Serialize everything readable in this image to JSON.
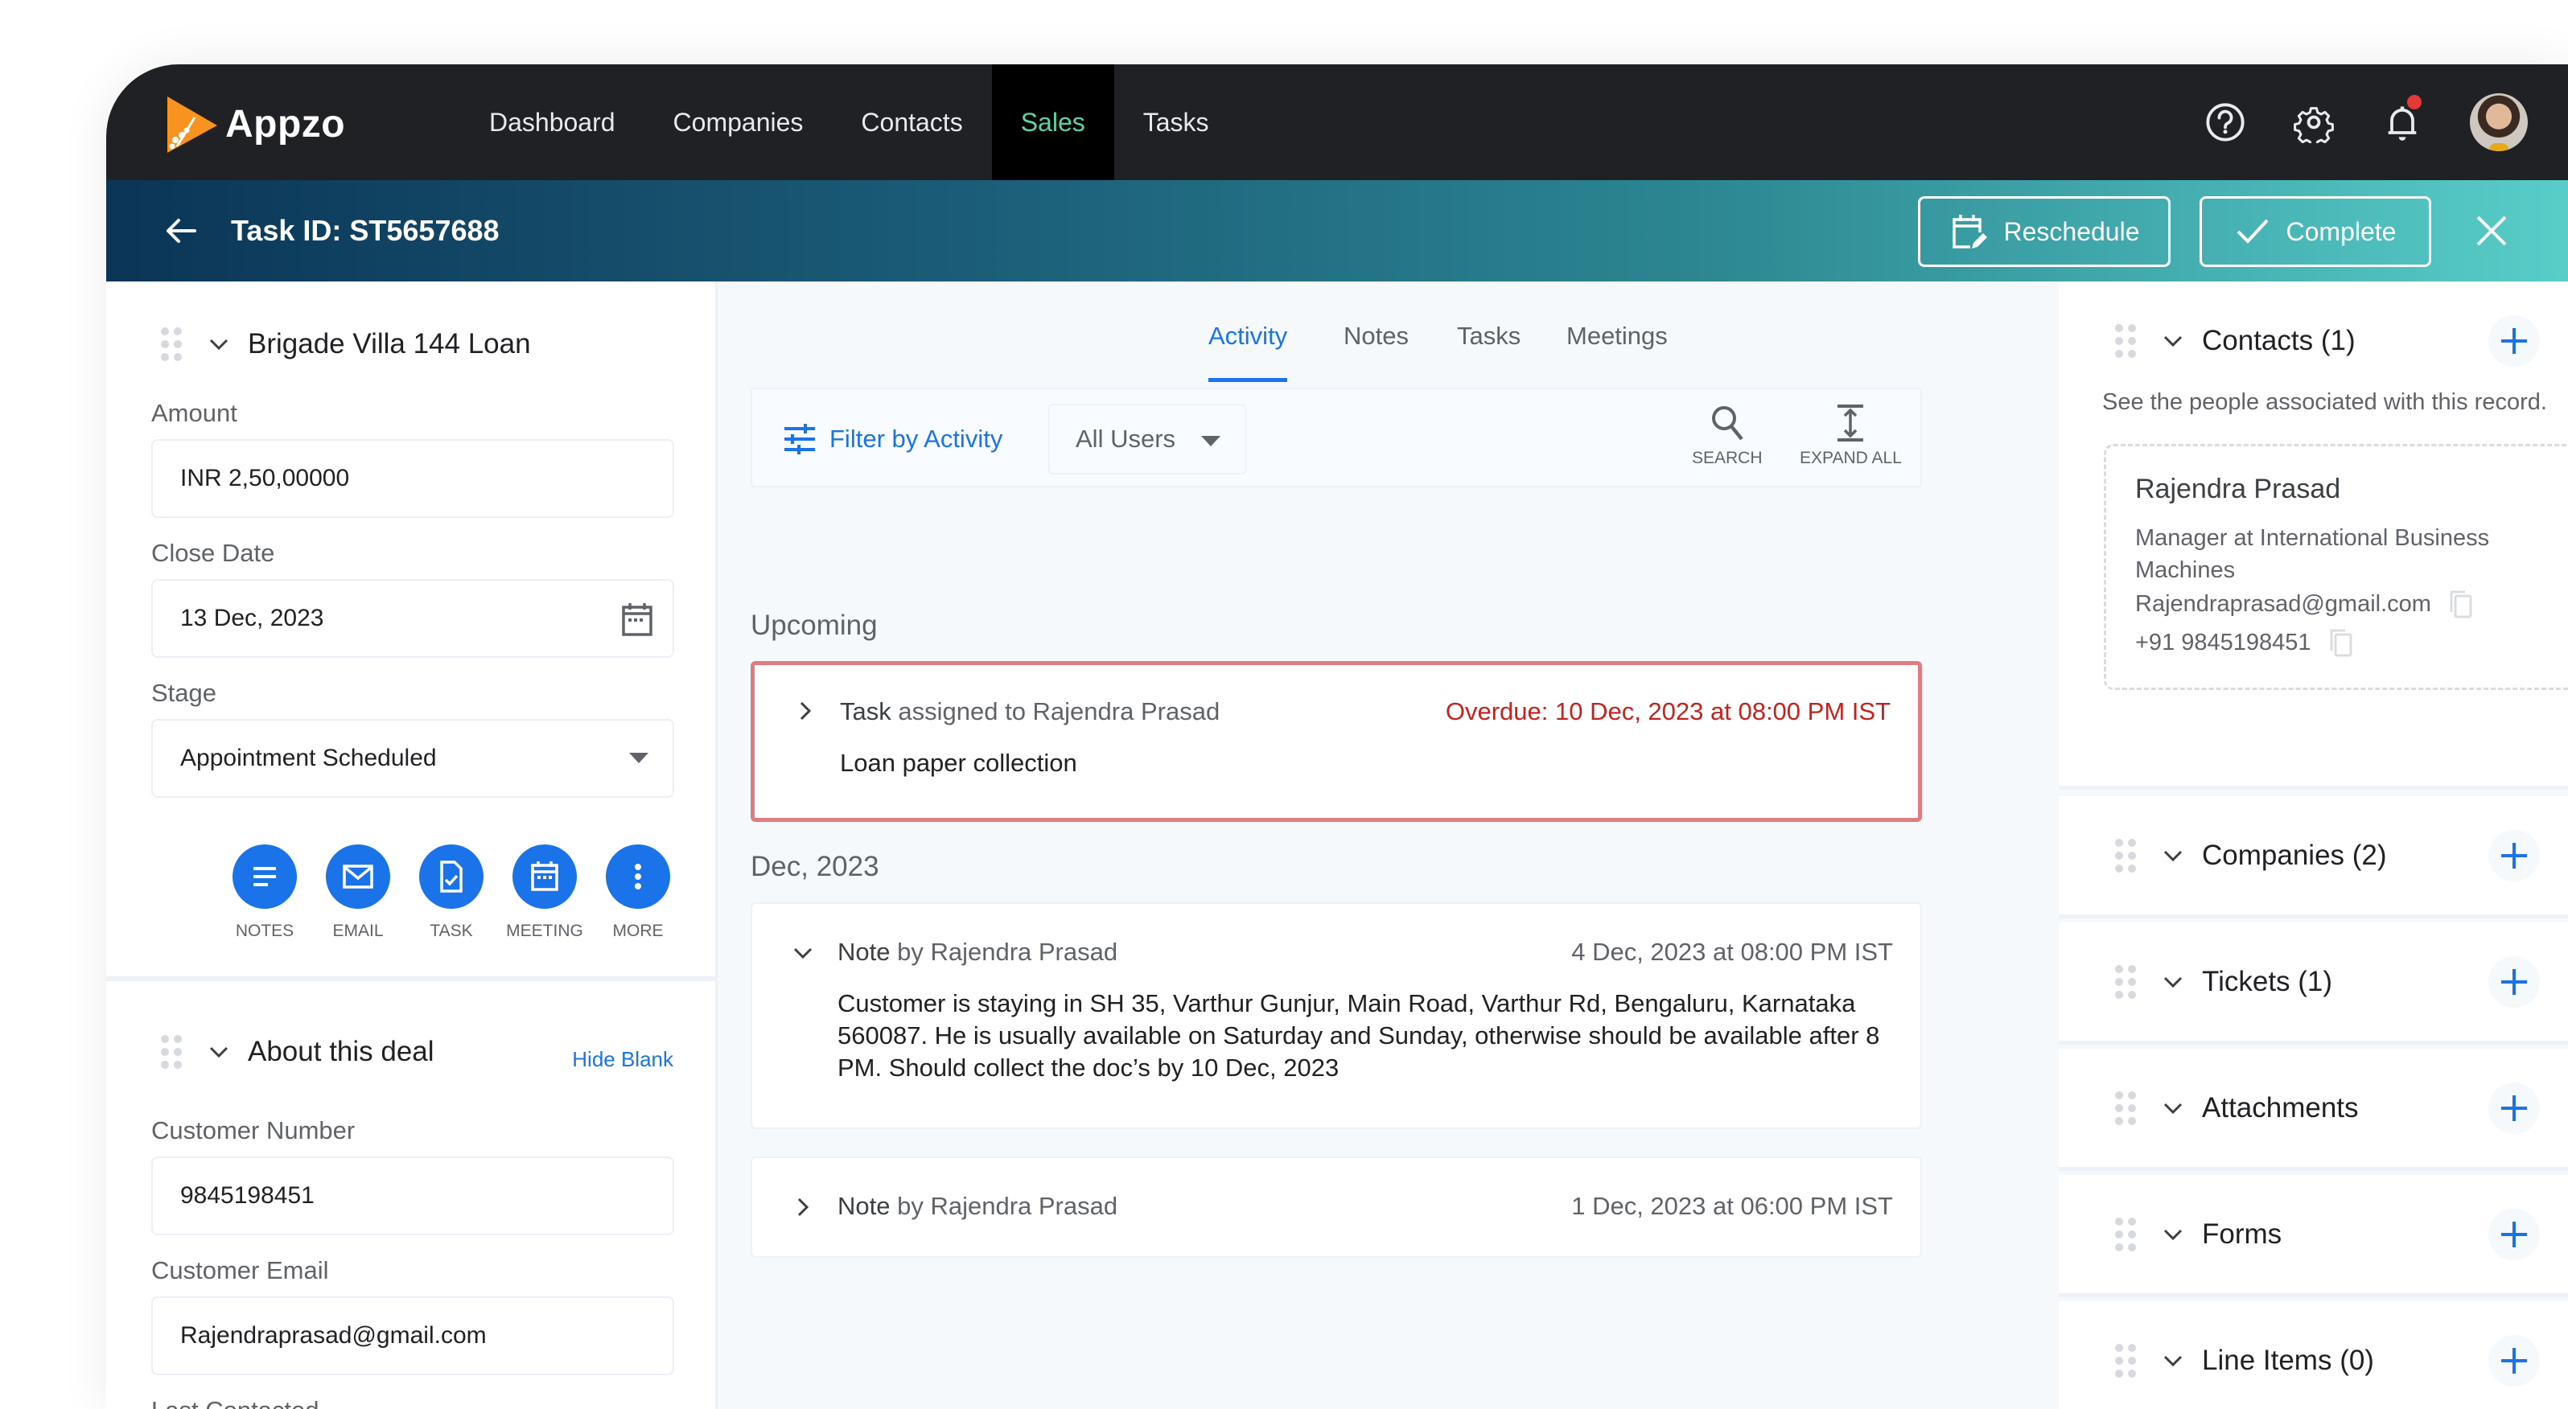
{
  "app": {
    "name": "Appzo",
    "brand_color": "#f7931e",
    "accent": "#1a73e8",
    "active_nav_color": "#5fd3a8"
  },
  "nav": {
    "items": [
      {
        "label": "Dashboard",
        "active": false
      },
      {
        "label": "Companies",
        "active": false
      },
      {
        "label": "Contacts",
        "active": false
      },
      {
        "label": "Sales",
        "active": true
      },
      {
        "label": "Tasks",
        "active": false
      }
    ],
    "icons": [
      "help-icon",
      "settings-icon",
      "notification-bell-icon",
      "user-avatar"
    ],
    "notification_badge": true
  },
  "task_header": {
    "title": "Task ID: ST5657688",
    "reschedule_label": "Reschedule",
    "complete_label": "Complete"
  },
  "left_panel": {
    "deal_section": {
      "title": "Brigade Villa 144 Loan",
      "fields": [
        {
          "label": "Amount",
          "value": "INR 2,50,00000"
        },
        {
          "label": "Close Date",
          "value": "13 Dec, 2023"
        },
        {
          "label": "Stage",
          "value": "Appointment Scheduled"
        }
      ],
      "actions": [
        {
          "label": "NOTES",
          "icon": "notes-icon"
        },
        {
          "label": "EMAIL",
          "icon": "email-icon"
        },
        {
          "label": "TASK",
          "icon": "task-icon"
        },
        {
          "label": "MEETING",
          "icon": "meeting-icon"
        },
        {
          "label": "MORE",
          "icon": "more-icon"
        }
      ]
    },
    "about_section": {
      "title": "About this deal",
      "hide_blank_label": "Hide Blank",
      "fields": [
        {
          "label": "Customer Number",
          "value": "9845198451"
        },
        {
          "label": "Customer Email",
          "value": "Rajendraprasad@gmail.com"
        },
        {
          "label": "Last Contacted",
          "value": ""
        }
      ]
    }
  },
  "center": {
    "tabs": [
      {
        "label": "Activity",
        "active": true
      },
      {
        "label": "Notes",
        "active": false
      },
      {
        "label": "Tasks",
        "active": false
      },
      {
        "label": "Meetings",
        "active": false
      }
    ],
    "toolbar": {
      "filter_label": "Filter by Activity",
      "users_select": "All Users",
      "search_label": "SEARCH",
      "expand_label": "EXPAND ALL"
    },
    "upcoming": {
      "label": "Upcoming",
      "items": [
        {
          "prefix": "Task",
          "header": "assigned to Rajendra Prasad",
          "date": "Overdue: 10 Dec, 2023 at 08:00 PM IST",
          "body": "Loan paper collection",
          "overdue": true,
          "expanded": false
        }
      ]
    },
    "month_group": {
      "label": "Dec, 2023",
      "items": [
        {
          "prefix": "Note",
          "header": "by Rajendra Prasad",
          "date": "4 Dec, 2023 at 08:00 PM IST",
          "body": "Customer is staying in SH 35, Varthur Gunjur, Main Road, Varthur Rd, Bengaluru, Karnataka 560087. He is usually available on Saturday and Sunday, otherwise should be available after 8 PM. Should collect the doc’s by 10 Dec, 2023",
          "expanded": true
        },
        {
          "prefix": "Note",
          "header": "by Rajendra Prasad",
          "date": "1 Dec, 2023 at 06:00 PM IST",
          "expanded": false
        }
      ]
    }
  },
  "right_panel": {
    "contacts": {
      "title": "Contacts (1)",
      "description": "See the people associated with this record.",
      "contact": {
        "name": "Rajendra Prasad",
        "role": "Manager at International Business Machines",
        "email": "Rajendraprasad@gmail.com",
        "phone": "+91 9845198451"
      }
    },
    "sections": [
      {
        "title": "Companies (2)"
      },
      {
        "title": "Tickets (1)"
      },
      {
        "title": "Attachments"
      },
      {
        "title": "Forms"
      },
      {
        "title": "Line Items (0)"
      }
    ]
  }
}
